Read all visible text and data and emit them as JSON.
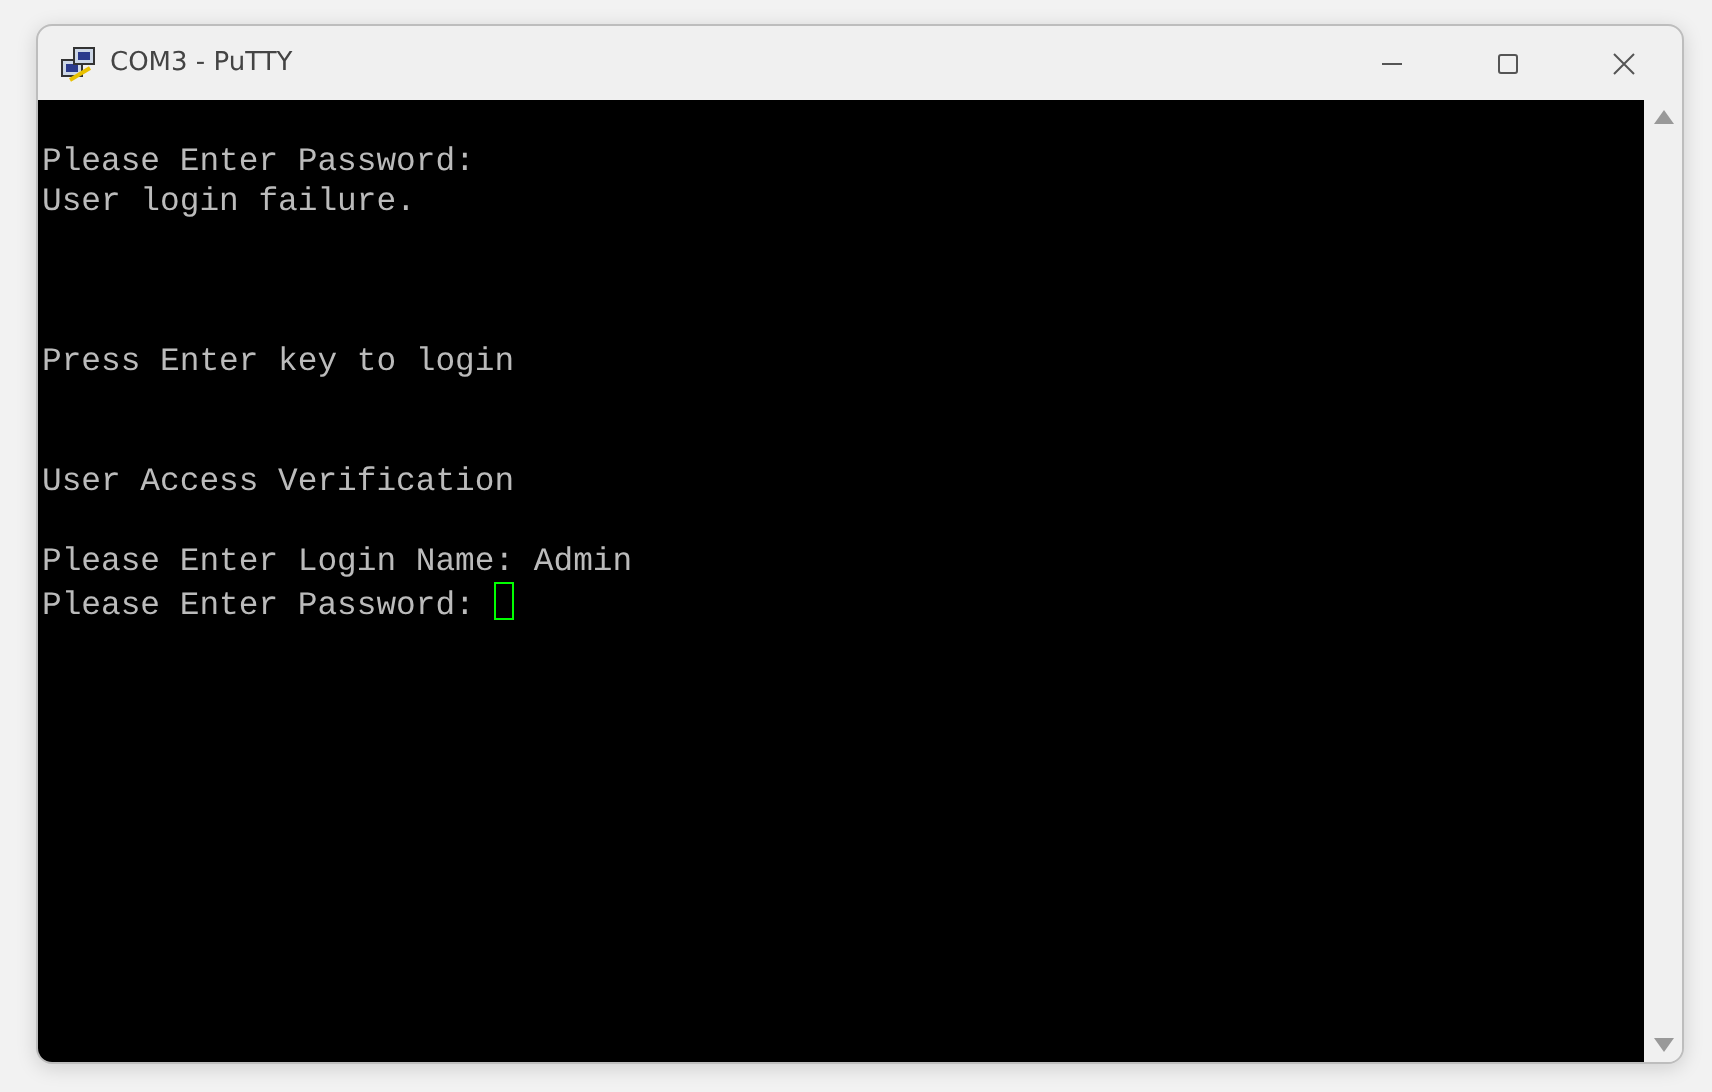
{
  "window": {
    "title": "COM3 - PuTTY"
  },
  "terminal": {
    "cursor": true,
    "lines": [
      {
        "kind": "text",
        "text": "Please Enter Password:"
      },
      {
        "kind": "text",
        "text": "User login failure."
      },
      {
        "kind": "blank"
      },
      {
        "kind": "blank"
      },
      {
        "kind": "blank"
      },
      {
        "kind": "text",
        "text": "Press Enter key to login"
      },
      {
        "kind": "blank"
      },
      {
        "kind": "blank"
      },
      {
        "kind": "text",
        "text": "User Access Verification"
      },
      {
        "kind": "blank"
      },
      {
        "kind": "text",
        "text": "Please Enter Login Name: Admin"
      },
      {
        "kind": "text",
        "text": "Please Enter Password: "
      }
    ]
  }
}
